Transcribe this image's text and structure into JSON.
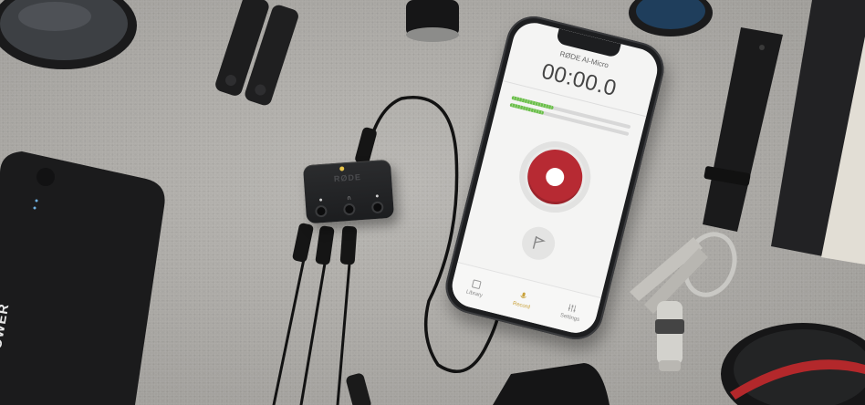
{
  "phone_app": {
    "title": "RØDE AI-Micro",
    "timer": "00:00.0",
    "levels": [
      0.35,
      0.28
    ],
    "tabs": [
      {
        "label": "Library",
        "icon": "library-icon"
      },
      {
        "label": "Record",
        "icon": "microphone-icon"
      },
      {
        "label": "Settings",
        "icon": "sliders-icon"
      }
    ]
  },
  "interface_brand": "RØDE",
  "power_bank_label": "POWER",
  "colors": {
    "record_red": "#b72a33",
    "level_green": "#6abf4b",
    "active_tab": "#c9a23c",
    "felt": "#aeaca8"
  }
}
